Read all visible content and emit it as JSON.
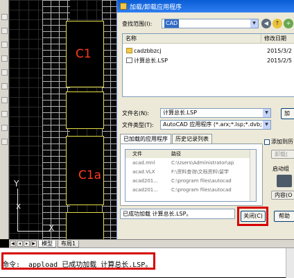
{
  "drawing": {
    "room_labels": [
      "C1",
      "C1a"
    ],
    "ucs": {
      "y_label": "Y",
      "x_label": "X",
      "origin_mark": "x"
    }
  },
  "layout_tabs": {
    "items": [
      "模型",
      "布局1"
    ],
    "active": "模型"
  },
  "command_line": {
    "text": "命令: _appload 已成功加载 计算总长.LSP。"
  },
  "dialog": {
    "title": "加载/卸载应用程序",
    "look_in_label": "查找范围(I):",
    "look_in_value": "CAD",
    "columns": {
      "name": "名称",
      "modified": "修改日期"
    },
    "files": [
      {
        "name": "cadzbbzcj",
        "date": "2015/3/2",
        "type": "folder"
      },
      {
        "name": "计算总长.LSP",
        "date": "2015/2/5",
        "type": "lsp"
      }
    ],
    "file_name_label": "文件名(N):",
    "file_name_value": "计算总长.LSP",
    "file_type_label": "文件类型(T):",
    "file_type_value": "AutoCAD 应用程序 (*.arx;*.lsp;*.dvb;",
    "load_button": "加",
    "tabs": [
      "已加载的应用程序",
      "历史记录列表"
    ],
    "loaded_columns": {
      "file": "文件",
      "path": "路径"
    },
    "loaded_apps": [
      {
        "file": "acad.mnl",
        "path": "C:\\Users\\Administrator\\ap"
      },
      {
        "file": "acad.VLX",
        "path": "F:\\资料查询\\文档资料\\留学"
      },
      {
        "file": "acad201...",
        "path": "C:\\program files\\autocad"
      },
      {
        "file": "acad201...",
        "path": "C:\\program files\\autocad"
      }
    ],
    "add_to_history_label": "添加到历",
    "unload_button": "卸载(",
    "startup_label": "启动组",
    "contents_button": "内容(O",
    "status_text": "已成功加载 计算总长.LSP。",
    "close_button": "关闭(C)",
    "help_button": "帮助"
  }
}
